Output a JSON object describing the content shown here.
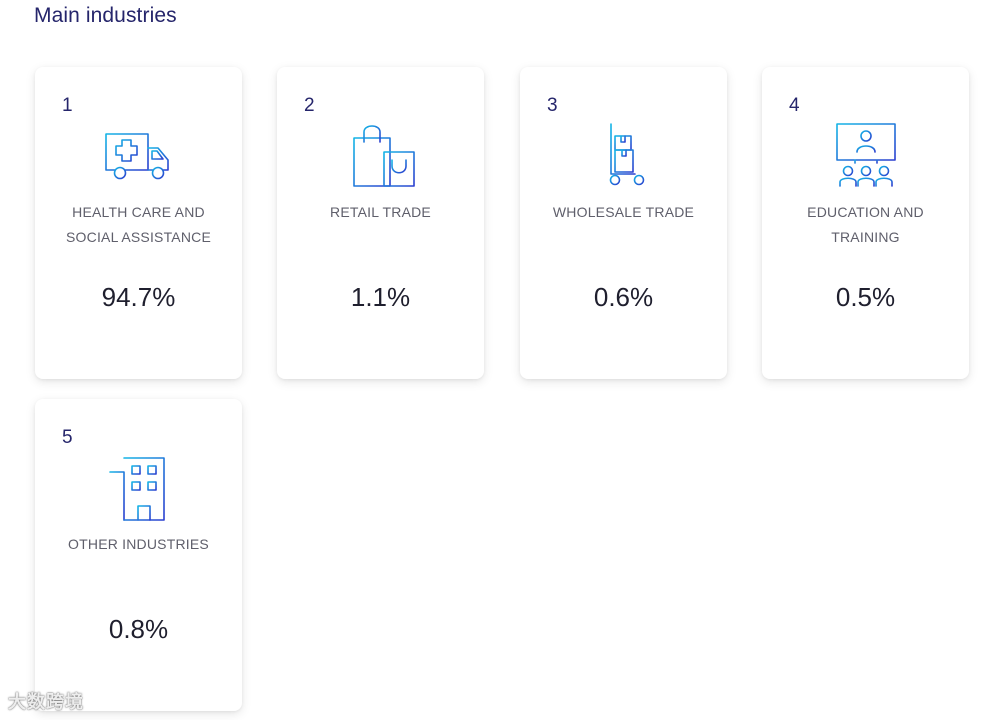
{
  "section": {
    "title": "Main industries"
  },
  "colors": {
    "heading": "#25256b",
    "icon_gradient_start": "#14b5e6",
    "icon_gradient_end": "#2b3ecf",
    "label": "#5f5f6b",
    "value": "#1f1f2e"
  },
  "cards": [
    {
      "rank": "1",
      "icon": "ambulance-icon",
      "label": "HEALTH CARE AND SOCIAL ASSISTANCE",
      "value": "94.7%"
    },
    {
      "rank": "2",
      "icon": "shopping-bags-icon",
      "label": "RETAIL TRADE",
      "value": "1.1%"
    },
    {
      "rank": "3",
      "icon": "hand-truck-boxes-icon",
      "label": "WHOLESALE TRADE",
      "value": "0.6%"
    },
    {
      "rank": "4",
      "icon": "presentation-audience-icon",
      "label": "EDUCATION AND TRAINING",
      "value": "0.5%"
    },
    {
      "rank": "5",
      "icon": "office-building-icon",
      "label": "OTHER INDUSTRIES",
      "value": "0.8%"
    }
  ],
  "watermark": {
    "text": "大数跨境"
  }
}
